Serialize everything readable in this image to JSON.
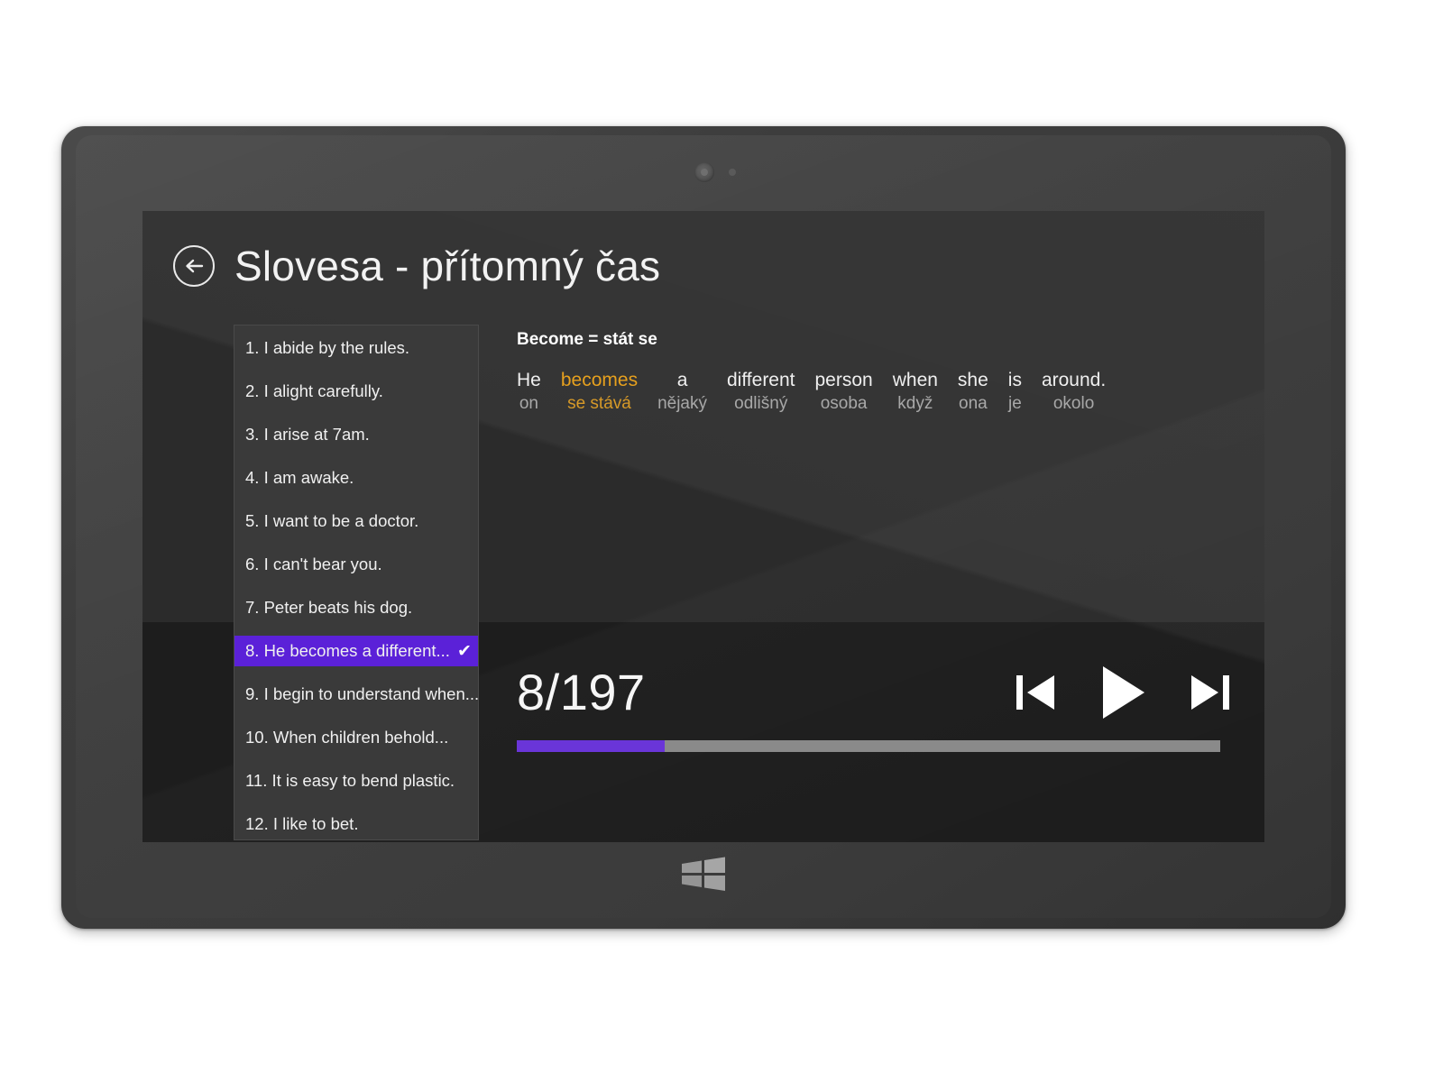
{
  "device": {
    "name": "windows-tablet",
    "camera_icon": "camera-icon",
    "sensor_icon": "light-sensor-icon",
    "home_button_icon": "windows-logo-icon"
  },
  "header": {
    "back_icon": "back-arrow-icon",
    "title": "Slovesa - přítomný čas"
  },
  "sentence_list": {
    "selected_index": 7,
    "check_glyph": "✔",
    "items": [
      {
        "label": "1. I abide by the rules."
      },
      {
        "label": "2. I alight carefully."
      },
      {
        "label": "3. I arise at 7am."
      },
      {
        "label": "4. I am awake."
      },
      {
        "label": "5. I want to be a doctor."
      },
      {
        "label": "6. I can't bear you."
      },
      {
        "label": "7. Peter beats his dog."
      },
      {
        "label": "8. He becomes a different..."
      },
      {
        "label": "9. I begin to understand when..."
      },
      {
        "label": "10. When children behold..."
      },
      {
        "label": "11. It is easy to bend plastic."
      },
      {
        "label": "12. I like to bet."
      }
    ]
  },
  "translation": {
    "verb_heading": "Become = stát se",
    "highlight_color": "#e6a01e",
    "words": [
      {
        "en": "He",
        "cz": "on",
        "highlight": false
      },
      {
        "en": "becomes",
        "cz": "se stává",
        "highlight": true
      },
      {
        "en": "a",
        "cz": "nějaký",
        "highlight": false
      },
      {
        "en": "different",
        "cz": "odlišný",
        "highlight": false
      },
      {
        "en": "person",
        "cz": "osoba",
        "highlight": false
      },
      {
        "en": "when",
        "cz": "když",
        "highlight": false
      },
      {
        "en": "she",
        "cz": "ona",
        "highlight": false
      },
      {
        "en": "is",
        "cz": "je",
        "highlight": false
      },
      {
        "en": "around.",
        "cz": "okolo",
        "highlight": false
      }
    ]
  },
  "player": {
    "counter": "8/197",
    "current": 8,
    "total": 197,
    "progress_percent": 21,
    "accent_color": "#6a35d8",
    "track_color": "#8a8a8a",
    "previous_icon": "skip-previous-icon",
    "play_icon": "play-icon",
    "next_icon": "skip-next-icon"
  },
  "theme": {
    "selection_purple": "#5b21d8",
    "panel_background": "#3a3a3a",
    "screen_background": "#1d1d1d",
    "chrome_background": "#2b2b2b"
  }
}
